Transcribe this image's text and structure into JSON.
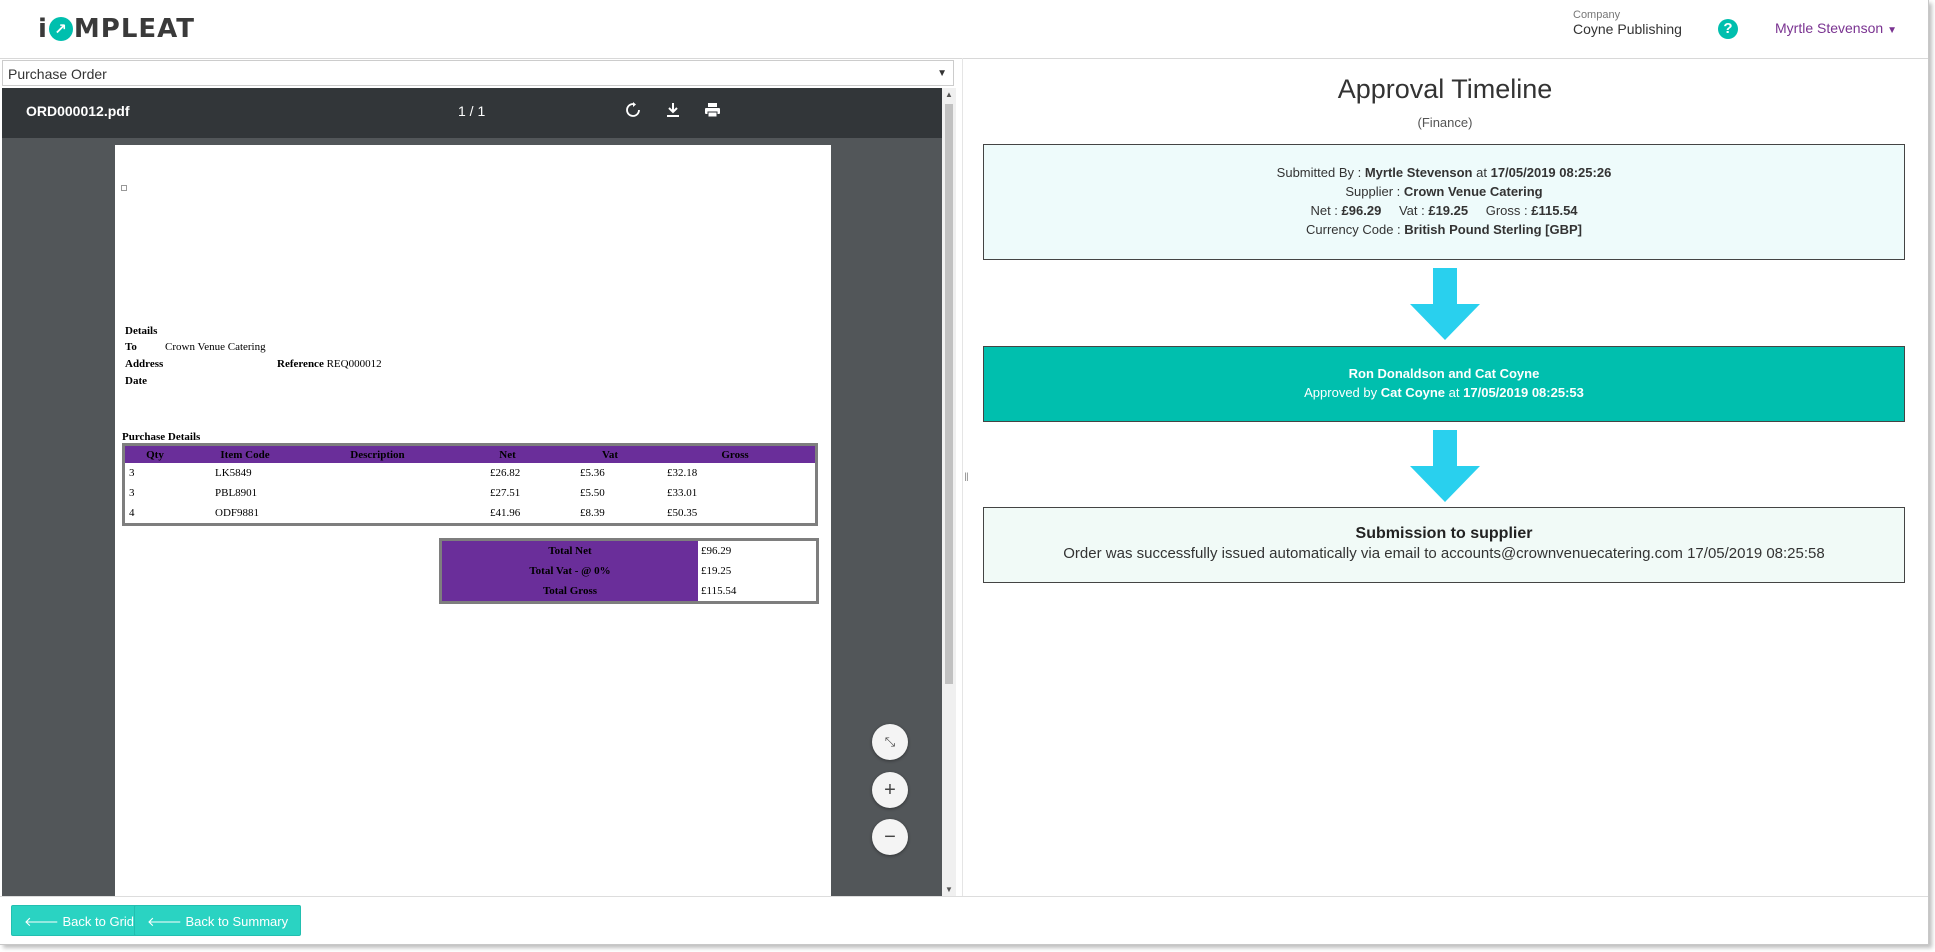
{
  "header": {
    "logo": {
      "prefix": "i",
      "mark": "C",
      "suffix": "MPLEAT"
    },
    "company_label": "Company",
    "company_name": "Coyne Publishing",
    "help": "?",
    "user_name": "Myrtle Stevenson"
  },
  "left": {
    "doc_select_value": "Purchase Order",
    "viewer": {
      "file_name": "ORD000012.pdf",
      "page_indicator": "1 / 1"
    },
    "pdf": {
      "details_heading": "Details",
      "to_label": "To",
      "to_value": "Crown Venue Catering",
      "address_label": "Address",
      "reference_label": "Reference",
      "reference_value": "REQ000012",
      "date_label": "Date",
      "purchase_details_heading": "Purchase Details",
      "columns": [
        "Qty",
        "Item Code",
        "Description",
        "Net",
        "Vat",
        "Gross"
      ],
      "rows": [
        [
          "3",
          "LK5849",
          "",
          "£26.82",
          "£5.36",
          "£32.18"
        ],
        [
          "3",
          "PBL8901",
          "",
          "£27.51",
          "£5.50",
          "£33.01"
        ],
        [
          "4",
          "ODF9881",
          "",
          "£41.96",
          "£8.39",
          "£50.35"
        ]
      ],
      "totals": [
        {
          "label": "Total Net",
          "value": "£96.29"
        },
        {
          "label": "Total Vat - @ 0%",
          "value": "£19.25"
        },
        {
          "label": "Total Gross",
          "value": "£115.54"
        }
      ]
    },
    "zoom_controls": {
      "fit": "fit-to-page",
      "zoom_in": "+",
      "zoom_out": "−"
    }
  },
  "timeline": {
    "title": "Approval Timeline",
    "subtitle": "(Finance)",
    "submitted": {
      "submitted_by_label": "Submitted By :",
      "submitted_by": "Myrtle Stevenson",
      "at_label": "at",
      "submitted_at": "17/05/2019 08:25:26",
      "supplier_label": "Supplier :",
      "supplier": "Crown Venue Catering",
      "net_label": "Net :",
      "net": "£96.29",
      "vat_label": "Vat :",
      "vat": "£19.25",
      "gross_label": "Gross :",
      "gross": "£115.54",
      "currency_label": "Currency Code :",
      "currency": "British Pound Sterling [GBP]"
    },
    "approval": {
      "approvers": "Ron Donaldson and Cat Coyne",
      "approved_by_label": "Approved by",
      "approved_by": "Cat Coyne",
      "at_label": "at",
      "approved_at": "17/05/2019 08:25:53"
    },
    "submission": {
      "title": "Submission to supplier",
      "text": "Order was successfully issued automatically via email to accounts@crownvenuecatering.com 17/05/2019 08:25:58"
    },
    "arrow_color": "#29d0ee"
  },
  "footer": {
    "back_to_grid": "Back to Grid",
    "back_to_summary": "Back to Summary"
  },
  "colors": {
    "teal": "#00bfae",
    "purple_header": "#6a2e9a",
    "user_link": "#7a3391"
  }
}
